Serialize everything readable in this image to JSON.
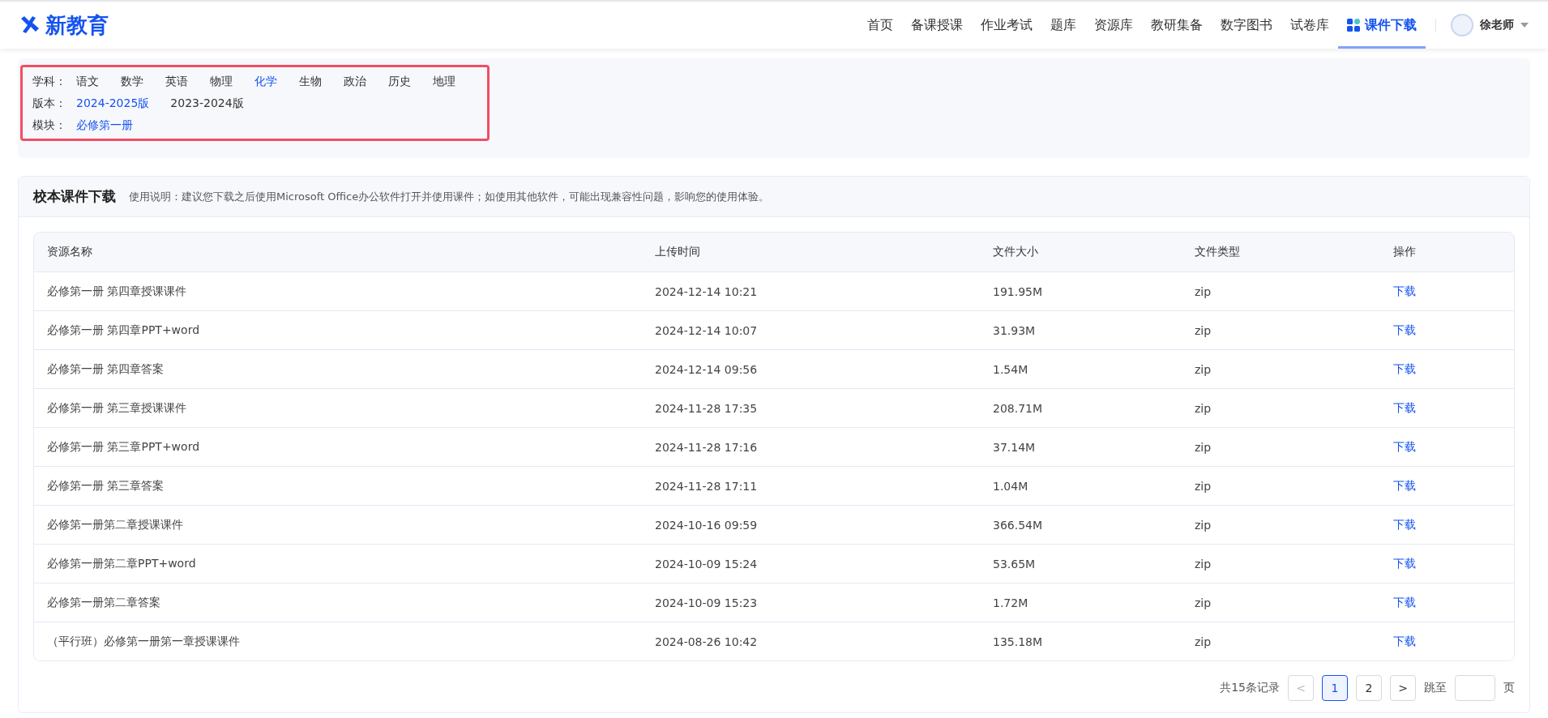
{
  "header": {
    "logo": "新教育",
    "nav": [
      {
        "label": "首页",
        "selected": false
      },
      {
        "label": "备课授课",
        "selected": false
      },
      {
        "label": "作业考试",
        "selected": false
      },
      {
        "label": "题库",
        "selected": false
      },
      {
        "label": "资源库",
        "selected": false
      },
      {
        "label": "教研集备",
        "selected": false
      },
      {
        "label": "数字图书",
        "selected": false
      },
      {
        "label": "试卷库",
        "selected": false
      },
      {
        "label": "课件下载",
        "selected": true
      }
    ],
    "user": "徐老师"
  },
  "filters": [
    {
      "label": "学科：",
      "options": [
        {
          "label": "语文",
          "selected": false
        },
        {
          "label": "数学",
          "selected": false
        },
        {
          "label": "英语",
          "selected": false
        },
        {
          "label": "物理",
          "selected": false
        },
        {
          "label": "化学",
          "selected": true
        },
        {
          "label": "生物",
          "selected": false
        },
        {
          "label": "政治",
          "selected": false
        },
        {
          "label": "历史",
          "selected": false
        },
        {
          "label": "地理",
          "selected": false
        }
      ]
    },
    {
      "label": "版本：",
      "options": [
        {
          "label": "2024-2025版",
          "selected": true
        },
        {
          "label": "2023-2024版",
          "selected": false
        }
      ]
    },
    {
      "label": "模块：",
      "options": [
        {
          "label": "必修第一册",
          "selected": true
        }
      ]
    }
  ],
  "section": {
    "title": "校本课件下载",
    "note": "使用说明：建议您下载之后使用Microsoft Office办公软件打开并使用课件；如使用其他软件，可能出现兼容性问题，影响您的使用体验。"
  },
  "table": {
    "columns": [
      "资源名称",
      "上传时间",
      "文件大小",
      "文件类型",
      "操作"
    ],
    "rows": [
      [
        "必修第一册 第四章授课课件",
        "2024-12-14 10:21",
        "191.95M",
        "zip",
        "下载"
      ],
      [
        "必修第一册 第四章PPT+word",
        "2024-12-14 10:07",
        "31.93M",
        "zip",
        "下载"
      ],
      [
        "必修第一册 第四章答案",
        "2024-12-14 09:56",
        "1.54M",
        "zip",
        "下载"
      ],
      [
        "必修第一册 第三章授课课件",
        "2024-11-28 17:35",
        "208.71M",
        "zip",
        "下载"
      ],
      [
        "必修第一册 第三章PPT+word",
        "2024-11-28 17:16",
        "37.14M",
        "zip",
        "下载"
      ],
      [
        "必修第一册 第三章答案",
        "2024-11-28 17:11",
        "1.04M",
        "zip",
        "下载"
      ],
      [
        "必修第一册第二章授课课件",
        "2024-10-16 09:59",
        "366.54M",
        "zip",
        "下载"
      ],
      [
        "必修第一册第二章PPT+word",
        "2024-10-09 15:24",
        "53.65M",
        "zip",
        "下载"
      ],
      [
        "必修第一册第二章答案",
        "2024-10-09 15:23",
        "1.72M",
        "zip",
        "下载"
      ],
      [
        "（平行班）必修第一册第一章授课课件",
        "2024-08-26 10:42",
        "135.18M",
        "zip",
        "下载"
      ]
    ]
  },
  "pagination": {
    "total": "共15条记录",
    "prev": "<",
    "pages": [
      {
        "label": "1",
        "selected": true
      },
      {
        "label": "2",
        "selected": false
      }
    ],
    "next": ">",
    "jump_label": "跳至",
    "jump_unit": "页"
  }
}
